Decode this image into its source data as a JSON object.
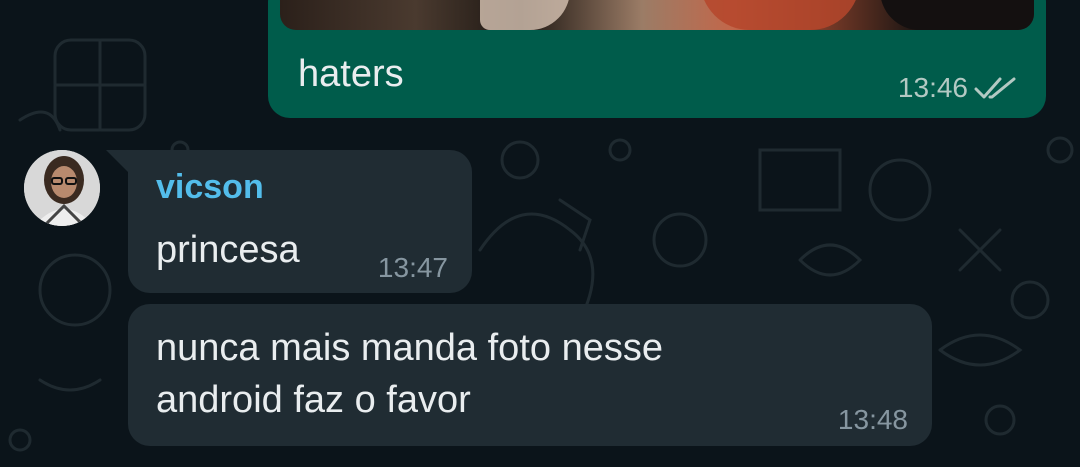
{
  "outgoing": {
    "caption": "haters",
    "time": "13:46",
    "status_icon": "double-check-read-icon"
  },
  "incoming": [
    {
      "sender": "vicson",
      "text": "princesa",
      "time": "13:47"
    },
    {
      "text_lines": [
        "nunca mais manda foto nesse",
        "android faz o favor"
      ],
      "time": "13:48"
    }
  ],
  "colors": {
    "background": "#0b141a",
    "outgoing_bubble": "#005c4b",
    "incoming_bubble": "#202c33",
    "sender_name": "#53bdeb",
    "text": "#e9edef",
    "timestamp": "#8696a0"
  }
}
